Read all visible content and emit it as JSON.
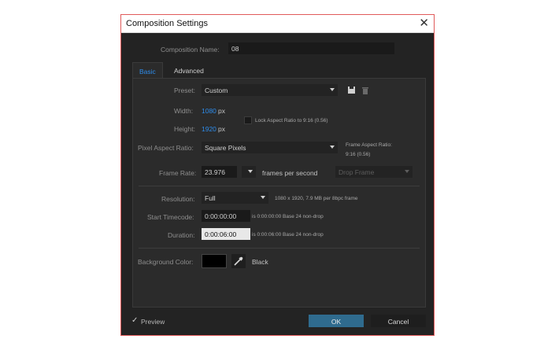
{
  "window": {
    "title": "Composition Settings",
    "close_glyph": "✕"
  },
  "composition": {
    "name_label": "Composition Name:",
    "name_value": "08"
  },
  "tabs": [
    {
      "label": "Basic",
      "active": true
    },
    {
      "label": "Advanced",
      "active": false
    }
  ],
  "basic": {
    "preset": {
      "label": "Preset:",
      "value": "Custom"
    },
    "width": {
      "label": "Width:",
      "value": "1080",
      "unit": "px"
    },
    "height": {
      "label": "Height:",
      "value": "1920",
      "unit": "px"
    },
    "lock_aspect": {
      "label": "Lock Aspect Ratio to 9:16 (0.56)",
      "checked": false
    },
    "pixel_aspect": {
      "label": "Pixel Aspect Ratio:",
      "value": "Square Pixels",
      "frame_aspect_label": "Frame Aspect Ratio:",
      "frame_aspect_value": "9:16 (0.56)"
    },
    "frame_rate": {
      "label": "Frame Rate:",
      "value": "23.976",
      "unit": "frames per second",
      "drop_frame": "Drop Frame"
    },
    "resolution": {
      "label": "Resolution:",
      "value": "Full",
      "info": "1080 x 1920, 7.9 MB per 8bpc frame"
    },
    "start_timecode": {
      "label": "Start Timecode:",
      "value": "0:00:00:00",
      "info": "is 0:00:00:00  Base 24  non-drop"
    },
    "duration": {
      "label": "Duration:",
      "value": "0:00:06:00",
      "info": "is 0:00:06:00  Base 24  non-drop"
    },
    "background": {
      "label": "Background Color:",
      "color": "#000000",
      "name": "Black"
    }
  },
  "footer": {
    "preview_label": "Preview",
    "preview_checked": true,
    "check_glyph": "✓",
    "ok_label": "OK",
    "cancel_label": "Cancel"
  },
  "colors": {
    "accent": "#2d8ceb",
    "ok_button": "#2f6b8e",
    "window_border": "#e05a5a",
    "background": "#232323"
  },
  "icons": [
    "close-icon",
    "save-preset-icon",
    "trash-icon",
    "dropdown-arrow-icon",
    "eyedropper-icon",
    "checkmark-icon"
  ]
}
